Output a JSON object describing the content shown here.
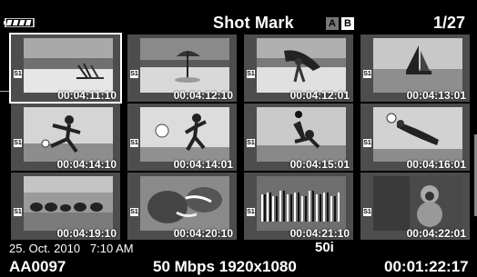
{
  "header": {
    "title": "Shot Mark",
    "badge_a": "A",
    "badge_b": "B",
    "page_indicator": "1/27",
    "battery_icon": "battery-full-icon"
  },
  "thumbnails": [
    {
      "timecode": "00:04:11:10",
      "mark": "S1",
      "scene": "beach chairs",
      "selected": true
    },
    {
      "timecode": "00:04:12:10",
      "mark": "S1",
      "scene": "beach umbrella",
      "selected": false
    },
    {
      "timecode": "00:04:12:01",
      "mark": "S1",
      "scene": "surfer with board",
      "selected": false
    },
    {
      "timecode": "00:04:13:01",
      "mark": "S1",
      "scene": "sailboat",
      "selected": false
    },
    {
      "timecode": "00:04:14:10",
      "mark": "S1",
      "scene": "soccer kick",
      "selected": false
    },
    {
      "timecode": "00:04:14:01",
      "mark": "S1",
      "scene": "soccer player",
      "selected": false
    },
    {
      "timecode": "00:04:15:01",
      "mark": "S1",
      "scene": "soccer bicycle kick",
      "selected": false
    },
    {
      "timecode": "00:04:16:01",
      "mark": "S1",
      "scene": "goalkeeper dive",
      "selected": false
    },
    {
      "timecode": "00:04:19:10",
      "mark": "S1",
      "scene": "elephant herd",
      "selected": false
    },
    {
      "timecode": "00:04:20:10",
      "mark": "S1",
      "scene": "elephants",
      "selected": false
    },
    {
      "timecode": "00:04:21:10",
      "mark": "S1",
      "scene": "zebras",
      "selected": false
    },
    {
      "timecode": "00:04:22:01",
      "mark": "S1",
      "scene": "monkey",
      "selected": false
    }
  ],
  "footer": {
    "date": "25. Oct. 2010",
    "time": "7:10 AM",
    "frame_rate": "50i",
    "clip_name": "AA0097",
    "bitrate_resolution": "50 Mbps 1920x1080",
    "duration": "00:01:22:17"
  },
  "colors": {
    "background": "#000000",
    "thumb_frame": "#4d4d4d",
    "selection": "#ffffff"
  }
}
